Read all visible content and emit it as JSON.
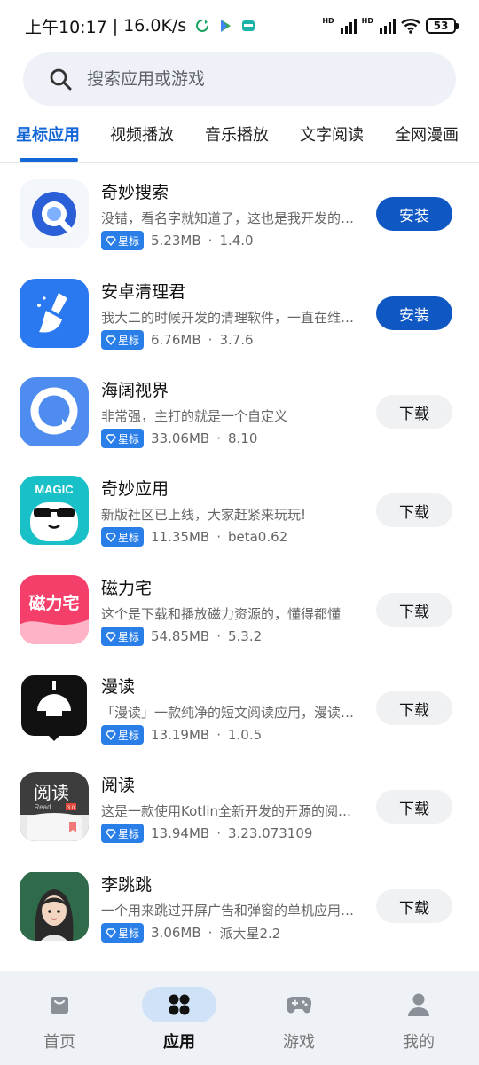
{
  "status_bar": {
    "time": "上午10:17",
    "separator": "|",
    "speed": "16.0K/s",
    "network_label": "HD",
    "battery": "53"
  },
  "search": {
    "placeholder": "搜索应用或游戏"
  },
  "tabs": [
    {
      "label": "星标应用",
      "active": true
    },
    {
      "label": "视频播放",
      "active": false
    },
    {
      "label": "音乐播放",
      "active": false
    },
    {
      "label": "文字阅读",
      "active": false
    },
    {
      "label": "全网漫画",
      "active": false
    }
  ],
  "badge_label": "星标",
  "apps": [
    {
      "name": "奇妙搜索",
      "desc": "没错，看名字就知道了，这也是我开发的一款应用",
      "size": "5.23MB",
      "version": "1.4.0",
      "action": "安装"
    },
    {
      "name": "安卓清理君",
      "desc": "我大二的时候开发的清理软件，一直在维护更新",
      "size": "6.76MB",
      "version": "3.7.6",
      "action": "安装"
    },
    {
      "name": "海阔视界",
      "desc": "非常强，主打的就是一个自定义",
      "size": "33.06MB",
      "version": "8.10",
      "action": "下载"
    },
    {
      "name": "奇妙应用",
      "desc": "新版社区已上线，大家赶紧来玩玩!",
      "size": "11.35MB",
      "version": "beta0.62",
      "action": "下载"
    },
    {
      "name": "磁力宅",
      "desc": "这个是下载和播放磁力资源的，懂得都懂",
      "size": "54.85MB",
      "version": "5.3.2",
      "action": "下载"
    },
    {
      "name": "漫读",
      "desc": "「漫读」一款纯净的短文阅读应用，漫读时光",
      "size": "13.19MB",
      "version": "1.0.5",
      "action": "下载"
    },
    {
      "name": "阅读",
      "desc": "这是一款使用Kotlin全新开发的开源的阅读软件",
      "size": "13.94MB",
      "version": "3.23.073109",
      "action": "下载"
    },
    {
      "name": "李跳跳",
      "desc": "一个用来跳过开屏广告和弹窗的单机应用程序",
      "size": "3.06MB",
      "version": "派大星2.2",
      "action": "下载"
    }
  ],
  "icon_text": {
    "magic": "MAGIC",
    "cili": "磁力宅",
    "yuedu": "阅读",
    "yuedu_sub": "Read",
    "yuedu_ver": "3.0"
  },
  "bottom_nav": [
    {
      "label": "首页",
      "icon": "home-icon",
      "active": false
    },
    {
      "label": "应用",
      "icon": "apps-icon",
      "active": true
    },
    {
      "label": "游戏",
      "icon": "gamepad-icon",
      "active": false
    },
    {
      "label": "我的",
      "icon": "person-icon",
      "active": false
    }
  ],
  "colors": {
    "accent": "#1366d6",
    "install_button": "#0f58c4",
    "badge": "#2a7ee8",
    "search_bg": "#eef2f8",
    "nav_bg": "#eef1f6",
    "nav_active_pill": "#cfe2f8"
  }
}
